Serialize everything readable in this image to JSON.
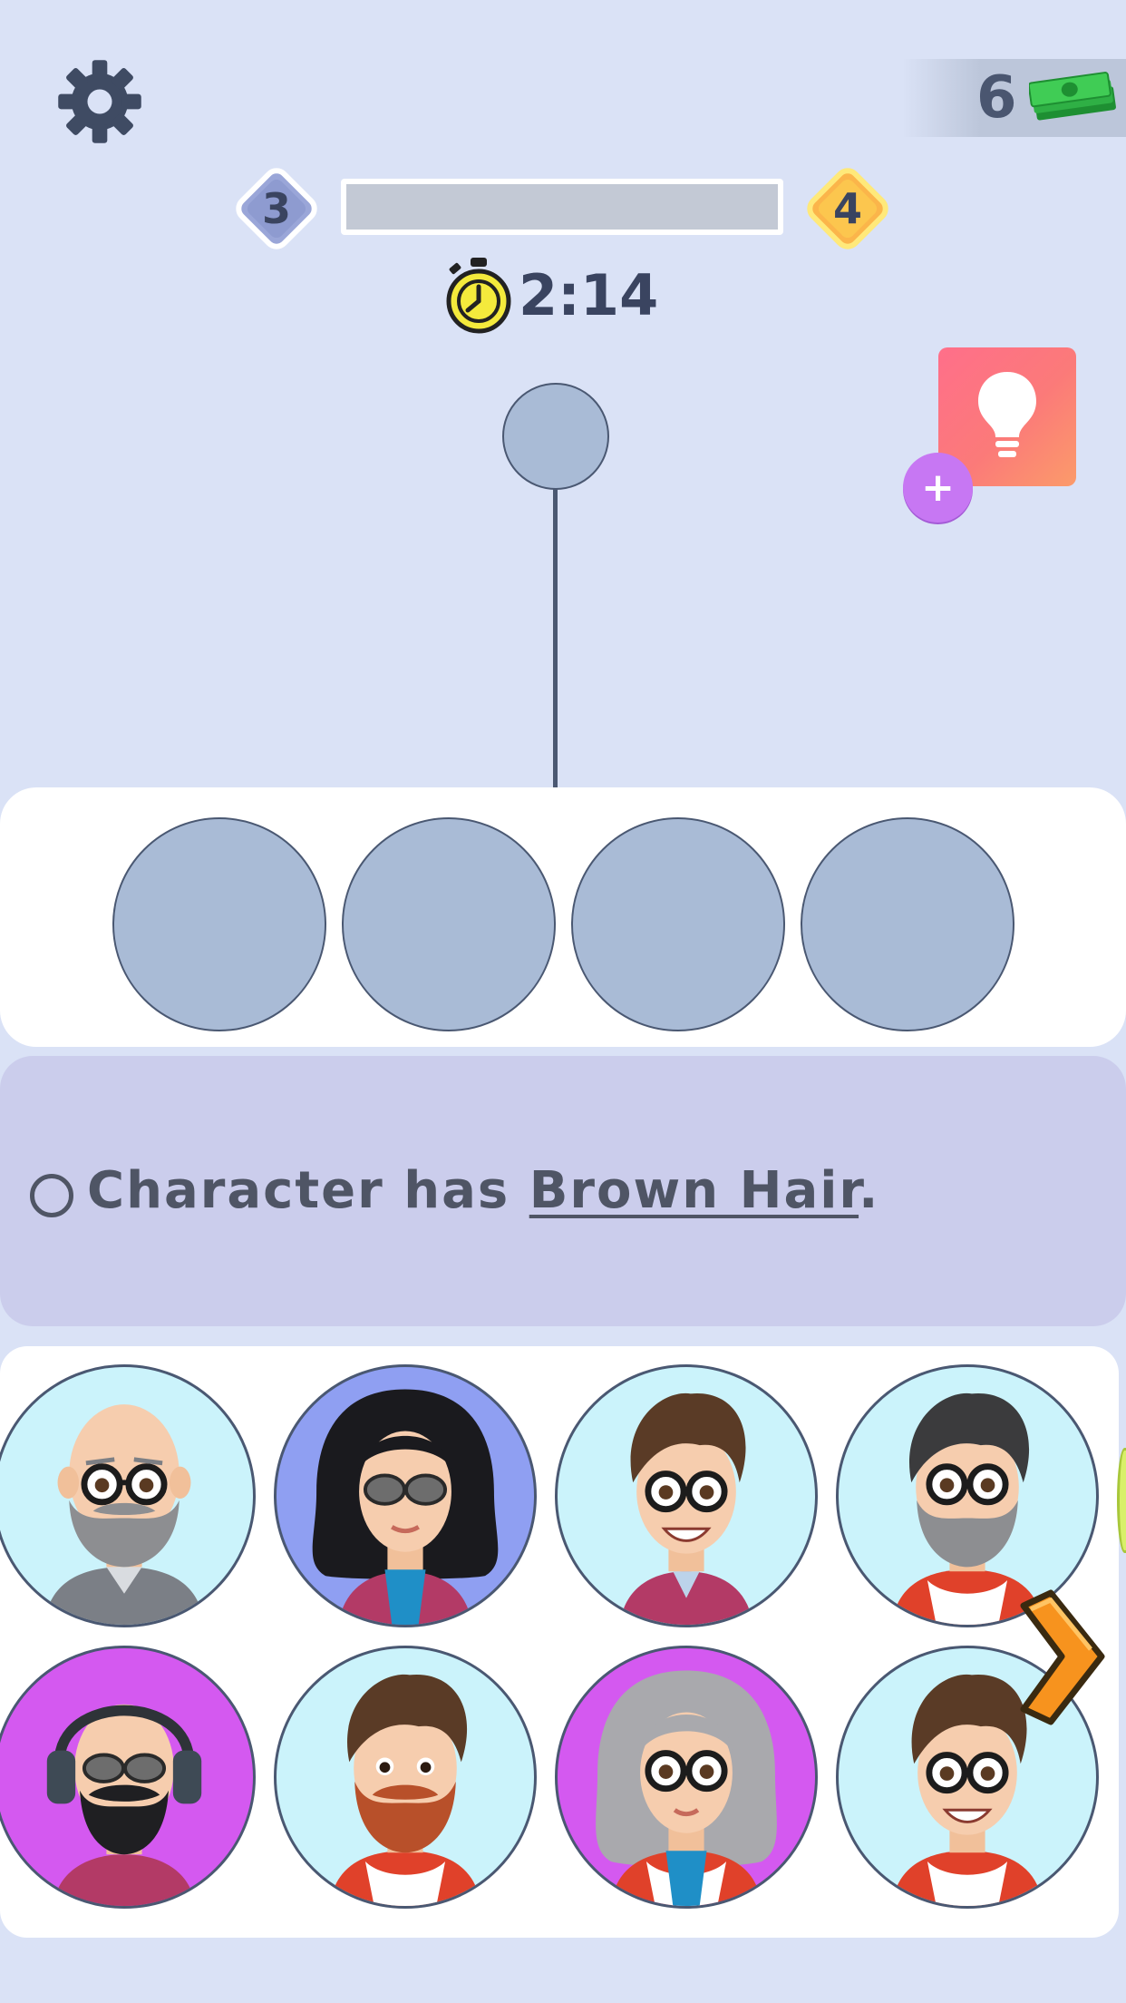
{
  "header": {
    "settings_icon": "gear-icon",
    "currency": {
      "count": "6",
      "icon": "cash-stack-icon"
    }
  },
  "level": {
    "current": "3",
    "next": "4",
    "progress_percent": 0,
    "colors": {
      "current": "#9aa6d8",
      "next": "#fbd046",
      "bar_track": "#c3c9d5"
    }
  },
  "timer": {
    "value": "2:14",
    "icon": "stopwatch-icon"
  },
  "hint": {
    "icon": "lightbulb-icon",
    "add_label": "+"
  },
  "clue": {
    "prefix": "Character has ",
    "keyword": "Brown Hair",
    "suffix": ".",
    "satisfied": false
  },
  "slots": {
    "count": 4,
    "fill_color": "#a9bbd6"
  },
  "characters": [
    {
      "id": "bald-gray-beard-glasses",
      "bg": "#cbf3fb",
      "hair": "none",
      "beard": "gray",
      "glasses": "clear"
    },
    {
      "id": "black-hair-woman-sunglasses",
      "bg": "#8f9ff2",
      "hair": "black-long",
      "beard": "none",
      "glasses": "dark"
    },
    {
      "id": "brown-hair-boy-glasses",
      "bg": "#cbf3fb",
      "hair": "brown",
      "beard": "none",
      "glasses": "clear"
    },
    {
      "id": "gray-hair-beard-glasses",
      "bg": "#cbf3fb",
      "hair": "dark-gray",
      "beard": "gray",
      "glasses": "clear"
    },
    {
      "id": "bald-headphones-black-beard",
      "bg": "#d459f0",
      "hair": "none",
      "beard": "black",
      "glasses": "dark"
    },
    {
      "id": "brown-hair-red-beard",
      "bg": "#cbf3fb",
      "hair": "brown",
      "beard": "red",
      "glasses": "none"
    },
    {
      "id": "gray-long-hair-woman",
      "bg": "#d459f0",
      "hair": "gray-long",
      "beard": "none",
      "glasses": "clear"
    },
    {
      "id": "brown-hair-glasses-hoodie",
      "bg": "#cbf3fb",
      "hair": "brown",
      "beard": "none",
      "glasses": "clear"
    }
  ],
  "navigation": {
    "next_icon": "chevron-right-icon"
  }
}
